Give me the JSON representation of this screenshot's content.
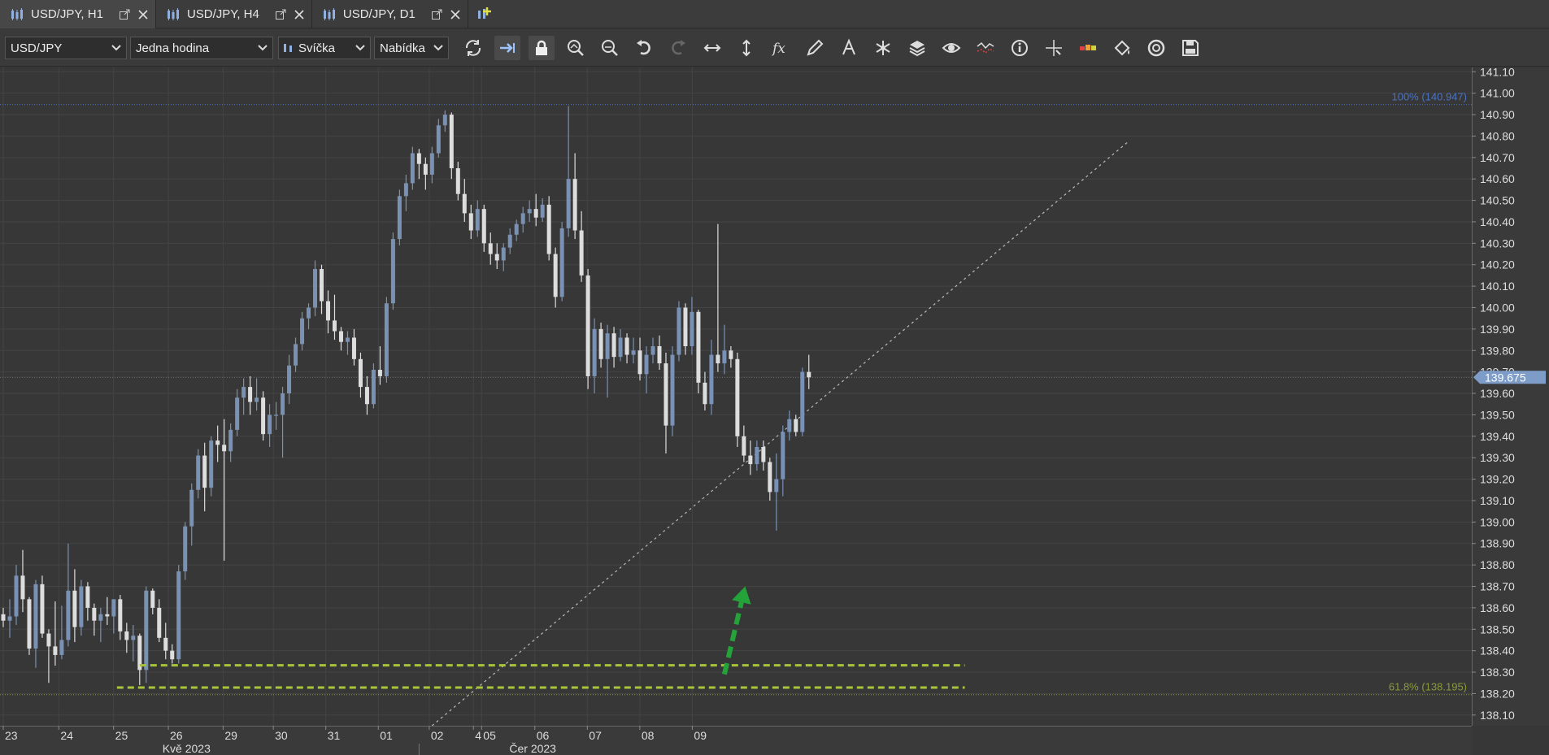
{
  "tabs": [
    {
      "label": "USD/JPY, H1",
      "active": true
    },
    {
      "label": "USD/JPY, H4",
      "active": false
    },
    {
      "label": "USD/JPY, D1",
      "active": false
    }
  ],
  "toolbar": {
    "instrument": "USD/JPY",
    "period": "Jedna hodina",
    "chart_type": "Svíčka",
    "price_side": "Nabídka",
    "tools": [
      "refresh-icon",
      "auto-scroll-icon",
      "lock-icon",
      "zoom-in-icon",
      "zoom-out-icon",
      "undo-icon",
      "redo-icon",
      "horizontal-scale-icon",
      "vertical-scale-icon",
      "indicators-fx-icon",
      "pencil-icon",
      "text-tool-icon",
      "objects-icon",
      "layers-icon",
      "eye-icon",
      "chart-compare-icon",
      "info-icon",
      "crosshair-icon",
      "heat-bar-icon",
      "paint-bucket-icon",
      "theme-icon",
      "save-icon"
    ]
  },
  "colors": {
    "background": "#373737",
    "grid": "#444444",
    "candle_up": "#7891b5",
    "candle_down": "#dddddd",
    "fib_100": "#4a72c4",
    "fib_618": "#8a9a3a",
    "support_dash": "#a8c43a",
    "arrow": "#24a33a",
    "price_badge": "#7d9dc8"
  },
  "chart_data": {
    "type": "candlestick",
    "instrument": "USD/JPY",
    "timeframe": "H1",
    "ylim": [
      138.05,
      141.12
    ],
    "y_ticks": [
      141.1,
      141.0,
      140.9,
      140.8,
      140.7,
      140.6,
      140.5,
      140.4,
      140.3,
      140.2,
      140.1,
      140.0,
      139.9,
      139.8,
      139.7,
      139.6,
      139.5,
      139.4,
      139.3,
      139.2,
      139.1,
      139.0,
      138.9,
      138.8,
      138.7,
      138.6,
      138.5,
      138.4,
      138.3,
      138.2,
      138.1
    ],
    "y_tick_labels": [
      "141.10",
      "141.00",
      "140.90",
      "140.80",
      "140.70",
      "140.60",
      "140.50",
      "140.40",
      "140.30",
      "140.20",
      "140.10",
      "140.00",
      "139.90",
      "139.80",
      "139.70",
      "139.60",
      "139.50",
      "139.40",
      "139.30",
      "139.20",
      "139.10",
      "139.00",
      "138.90",
      "138.80",
      "138.70",
      "138.60",
      "138.50",
      "138.40",
      "138.30",
      "138.20",
      "138.10"
    ],
    "current_price": 139.675,
    "current_price_label": "139.675",
    "x_labels": [
      "23",
      "24",
      "25",
      "26",
      "29",
      "30",
      "31",
      "01",
      "02",
      "4",
      "05",
      "06",
      "07",
      "08",
      "09"
    ],
    "x_label_pos": [
      0.0,
      8.56,
      16.98,
      25.41,
      33.84,
      41.57,
      49.65,
      57.73,
      65.57,
      72.37,
      73.63,
      81.82,
      89.9,
      97.98,
      106.06
    ],
    "month_labels": [
      "Kvě 2023",
      "Čer 2023"
    ],
    "month_label_pos": [
      28.2,
      81.5
    ],
    "candles": [
      [
        138.57,
        138.6,
        138.51,
        138.54
      ],
      [
        138.54,
        138.64,
        138.46,
        138.56
      ],
      [
        138.56,
        138.8,
        138.52,
        138.75
      ],
      [
        138.75,
        138.87,
        138.58,
        138.64
      ],
      [
        138.64,
        138.65,
        138.38,
        138.41
      ],
      [
        138.41,
        138.73,
        138.32,
        138.71
      ],
      [
        138.71,
        138.75,
        138.46,
        138.48
      ],
      [
        138.48,
        138.5,
        138.25,
        138.42
      ],
      [
        138.42,
        138.63,
        138.33,
        138.38
      ],
      [
        138.38,
        138.61,
        138.36,
        138.45
      ],
      [
        138.45,
        138.9,
        138.42,
        138.68
      ],
      [
        138.68,
        138.78,
        138.44,
        138.51
      ],
      [
        138.51,
        138.73,
        138.47,
        138.7
      ],
      [
        138.7,
        138.72,
        138.54,
        138.6
      ],
      [
        138.6,
        138.62,
        138.47,
        138.54
      ],
      [
        138.54,
        138.6,
        138.44,
        138.57
      ],
      [
        138.57,
        138.65,
        138.52,
        138.56
      ],
      [
        138.56,
        138.63,
        138.48,
        138.64
      ],
      [
        138.64,
        138.66,
        138.45,
        138.49
      ],
      [
        138.49,
        138.53,
        138.39,
        138.45
      ],
      [
        138.45,
        138.52,
        138.35,
        138.47
      ],
      [
        138.47,
        138.48,
        138.24,
        138.31
      ],
      [
        138.31,
        138.7,
        138.25,
        138.68
      ],
      [
        138.68,
        138.69,
        138.57,
        138.6
      ],
      [
        138.6,
        138.64,
        138.44,
        138.46
      ],
      [
        138.46,
        138.53,
        138.36,
        138.4
      ],
      [
        138.4,
        138.43,
        138.34,
        138.36
      ],
      [
        138.36,
        138.8,
        138.34,
        138.77
      ],
      [
        138.77,
        139.0,
        138.73,
        138.98
      ],
      [
        138.98,
        139.18,
        138.89,
        139.15
      ],
      [
        139.15,
        139.34,
        139.11,
        139.31
      ],
      [
        139.31,
        139.37,
        139.05,
        139.16
      ],
      [
        139.16,
        139.4,
        139.12,
        139.38
      ],
      [
        139.38,
        139.45,
        139.28,
        139.36
      ],
      [
        139.36,
        139.48,
        138.82,
        139.33
      ],
      [
        139.33,
        139.46,
        139.28,
        139.43
      ],
      [
        139.43,
        139.62,
        139.4,
        139.58
      ],
      [
        139.58,
        139.67,
        139.5,
        139.63
      ],
      [
        139.63,
        139.68,
        139.5,
        139.56
      ],
      [
        139.56,
        139.67,
        139.52,
        139.58
      ],
      [
        139.58,
        139.61,
        139.38,
        139.41
      ],
      [
        139.41,
        139.55,
        139.35,
        139.5
      ],
      [
        139.5,
        139.56,
        139.43,
        139.5
      ],
      [
        139.5,
        139.63,
        139.3,
        139.6
      ],
      [
        139.6,
        139.78,
        139.55,
        139.73
      ],
      [
        139.73,
        139.86,
        139.7,
        139.83
      ],
      [
        139.83,
        139.98,
        139.8,
        139.95
      ],
      [
        139.95,
        140.02,
        139.9,
        140.0
      ],
      [
        140.0,
        140.22,
        139.96,
        140.18
      ],
      [
        140.18,
        140.2,
        139.97,
        140.03
      ],
      [
        140.03,
        140.08,
        139.88,
        139.94
      ],
      [
        139.94,
        140.06,
        139.85,
        139.89
      ],
      [
        139.89,
        139.91,
        139.8,
        139.84
      ],
      [
        139.84,
        139.89,
        139.78,
        139.86
      ],
      [
        139.86,
        139.9,
        139.73,
        139.76
      ],
      [
        139.76,
        139.79,
        139.58,
        139.63
      ],
      [
        139.63,
        139.68,
        139.5,
        139.55
      ],
      [
        139.55,
        139.74,
        139.53,
        139.71
      ],
      [
        139.71,
        139.82,
        139.64,
        139.68
      ],
      [
        139.68,
        140.05,
        139.65,
        140.02
      ],
      [
        140.02,
        140.35,
        139.99,
        140.32
      ],
      [
        140.32,
        140.55,
        140.29,
        140.52
      ],
      [
        140.52,
        140.62,
        140.45,
        140.58
      ],
      [
        140.58,
        140.75,
        140.55,
        140.72
      ],
      [
        140.72,
        140.74,
        140.6,
        140.67
      ],
      [
        140.67,
        140.7,
        140.55,
        140.62
      ],
      [
        140.62,
        140.75,
        140.58,
        140.72
      ],
      [
        140.72,
        140.88,
        140.7,
        140.85
      ],
      [
        140.85,
        140.92,
        140.82,
        140.9
      ],
      [
        140.9,
        140.91,
        140.6,
        140.65
      ],
      [
        140.65,
        140.68,
        140.5,
        140.53
      ],
      [
        140.53,
        140.6,
        140.4,
        140.44
      ],
      [
        140.44,
        140.48,
        140.32,
        140.36
      ],
      [
        140.36,
        140.5,
        140.33,
        140.46
      ],
      [
        140.46,
        140.48,
        140.26,
        140.3
      ],
      [
        140.3,
        140.35,
        140.2,
        140.25
      ],
      [
        140.25,
        140.3,
        140.18,
        140.22
      ],
      [
        140.22,
        140.3,
        140.17,
        140.28
      ],
      [
        140.28,
        140.37,
        140.25,
        140.34
      ],
      [
        140.34,
        140.41,
        140.31,
        140.39
      ],
      [
        140.39,
        140.47,
        140.35,
        140.44
      ],
      [
        140.44,
        140.5,
        140.4,
        140.46
      ],
      [
        140.46,
        140.53,
        140.38,
        140.42
      ],
      [
        140.42,
        140.51,
        140.4,
        140.48
      ],
      [
        140.48,
        140.52,
        140.22,
        140.25
      ],
      [
        140.25,
        140.28,
        140.0,
        140.05
      ],
      [
        140.05,
        140.4,
        140.03,
        140.37
      ],
      [
        140.37,
        140.94,
        140.33,
        140.6
      ],
      [
        140.6,
        140.72,
        140.32,
        140.36
      ],
      [
        140.36,
        140.45,
        140.12,
        140.15
      ],
      [
        140.15,
        140.18,
        139.62,
        139.68
      ],
      [
        139.68,
        139.95,
        139.6,
        139.9
      ],
      [
        139.9,
        139.93,
        139.72,
        139.76
      ],
      [
        139.76,
        139.92,
        139.58,
        139.88
      ],
      [
        139.88,
        139.91,
        139.72,
        139.77
      ],
      [
        139.77,
        139.9,
        139.75,
        139.86
      ],
      [
        139.86,
        139.88,
        139.74,
        139.78
      ],
      [
        139.78,
        139.86,
        139.74,
        139.8
      ],
      [
        139.8,
        139.86,
        139.66,
        139.69
      ],
      [
        139.69,
        139.82,
        139.6,
        139.78
      ],
      [
        139.78,
        139.86,
        139.74,
        139.82
      ],
      [
        139.82,
        139.87,
        139.71,
        139.74
      ],
      [
        139.74,
        139.79,
        139.32,
        139.45
      ],
      [
        139.45,
        139.82,
        139.4,
        139.78
      ],
      [
        139.78,
        140.03,
        139.75,
        140.0
      ],
      [
        140.0,
        140.02,
        139.78,
        139.82
      ],
      [
        139.82,
        140.05,
        139.78,
        139.98
      ],
      [
        139.98,
        139.99,
        139.6,
        139.65
      ],
      [
        139.65,
        139.7,
        139.52,
        139.55
      ],
      [
        139.55,
        139.85,
        139.5,
        139.78
      ],
      [
        139.78,
        140.39,
        139.7,
        139.74
      ],
      [
        139.74,
        139.92,
        139.69,
        139.8
      ],
      [
        139.8,
        139.82,
        139.72,
        139.76
      ],
      [
        139.76,
        139.79,
        139.35,
        139.4
      ],
      [
        139.4,
        139.45,
        139.28,
        139.31
      ],
      [
        139.31,
        139.38,
        139.22,
        139.27
      ],
      [
        139.27,
        139.38,
        139.24,
        139.35
      ],
      [
        139.35,
        139.38,
        139.24,
        139.28
      ],
      [
        139.28,
        139.3,
        139.1,
        139.14
      ],
      [
        139.14,
        139.32,
        138.96,
        139.2
      ],
      [
        139.2,
        139.45,
        139.12,
        139.42
      ],
      [
        139.42,
        139.52,
        139.38,
        139.48
      ],
      [
        139.48,
        139.5,
        139.4,
        139.42
      ],
      [
        139.42,
        139.72,
        139.4,
        139.7
      ],
      [
        139.7,
        139.78,
        139.62,
        139.675
      ]
    ],
    "levels": [
      {
        "label": "100% (140.947)",
        "value": 140.947,
        "color_key": "fib_100"
      },
      {
        "label": "61.8% (138.195)",
        "value": 138.195,
        "color_key": "fib_618"
      }
    ],
    "support_lines": [
      {
        "value": 138.332,
        "x_start": 21.0,
        "x_end": 148.0
      },
      {
        "value": 138.228,
        "x_start": 17.5,
        "x_end": 148.0
      }
    ],
    "trendline": {
      "x1": 66.0,
      "y1": 138.05,
      "x2": 173.0,
      "y2": 140.77
    },
    "arrow": {
      "x1": 111.0,
      "y1": 138.29,
      "x2": 114.2,
      "y2": 138.7
    },
    "grid": true
  }
}
